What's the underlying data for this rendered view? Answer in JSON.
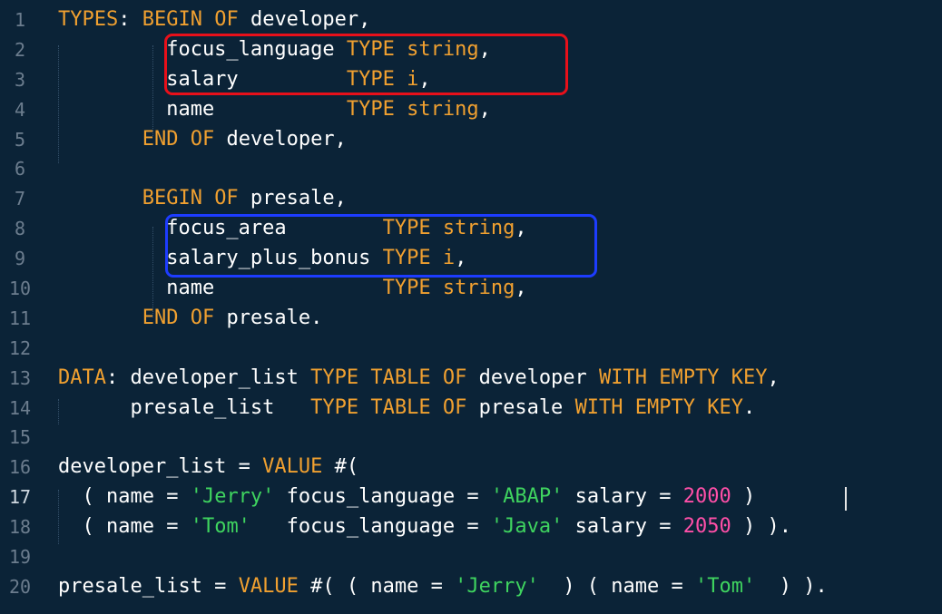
{
  "editor": {
    "active_line": 17,
    "colors": {
      "background": "#0b2337",
      "keyword": "#f0a030",
      "string": "#3fd45f",
      "number": "#ff4fa8",
      "identifier": "#ffffff",
      "line_number": "#6c7d8e",
      "highlight_red": "#e8101a",
      "highlight_blue": "#1d3cff"
    },
    "lines": [
      {
        "n": "1",
        "tokens": [
          {
            "t": "TYPES",
            "c": "kw"
          },
          {
            "t": ": ",
            "c": "id"
          },
          {
            "t": "BEGIN OF",
            "c": "kw"
          },
          {
            "t": " developer,",
            "c": "id"
          }
        ]
      },
      {
        "n": "2",
        "tokens": [
          {
            "t": "         focus_language ",
            "c": "id"
          },
          {
            "t": "TYPE",
            "c": "kw"
          },
          {
            "t": " ",
            "c": "id"
          },
          {
            "t": "string",
            "c": "kw"
          },
          {
            "t": ",",
            "c": "id"
          }
        ]
      },
      {
        "n": "3",
        "tokens": [
          {
            "t": "         salary         ",
            "c": "id"
          },
          {
            "t": "TYPE",
            "c": "kw"
          },
          {
            "t": " ",
            "c": "id"
          },
          {
            "t": "i",
            "c": "kw"
          },
          {
            "t": ",",
            "c": "id"
          }
        ]
      },
      {
        "n": "4",
        "tokens": [
          {
            "t": "         name           ",
            "c": "id"
          },
          {
            "t": "TYPE",
            "c": "kw"
          },
          {
            "t": " ",
            "c": "id"
          },
          {
            "t": "string",
            "c": "kw"
          },
          {
            "t": ",",
            "c": "id"
          }
        ]
      },
      {
        "n": "5",
        "tokens": [
          {
            "t": "       ",
            "c": "id"
          },
          {
            "t": "END OF",
            "c": "kw"
          },
          {
            "t": " developer,",
            "c": "id"
          }
        ]
      },
      {
        "n": "6",
        "tokens": []
      },
      {
        "n": "7",
        "tokens": [
          {
            "t": "       ",
            "c": "id"
          },
          {
            "t": "BEGIN OF",
            "c": "kw"
          },
          {
            "t": " presale,",
            "c": "id"
          }
        ]
      },
      {
        "n": "8",
        "tokens": [
          {
            "t": "         focus_area        ",
            "c": "id"
          },
          {
            "t": "TYPE",
            "c": "kw"
          },
          {
            "t": " ",
            "c": "id"
          },
          {
            "t": "string",
            "c": "kw"
          },
          {
            "t": ",",
            "c": "id"
          }
        ]
      },
      {
        "n": "9",
        "tokens": [
          {
            "t": "         salary_plus_bonus ",
            "c": "id"
          },
          {
            "t": "TYPE",
            "c": "kw"
          },
          {
            "t": " ",
            "c": "id"
          },
          {
            "t": "i",
            "c": "kw"
          },
          {
            "t": ",",
            "c": "id"
          }
        ]
      },
      {
        "n": "10",
        "tokens": [
          {
            "t": "         name              ",
            "c": "id"
          },
          {
            "t": "TYPE",
            "c": "kw"
          },
          {
            "t": " ",
            "c": "id"
          },
          {
            "t": "string",
            "c": "kw"
          },
          {
            "t": ",",
            "c": "id"
          }
        ]
      },
      {
        "n": "11",
        "tokens": [
          {
            "t": "       ",
            "c": "id"
          },
          {
            "t": "END OF",
            "c": "kw"
          },
          {
            "t": " presale.",
            "c": "id"
          }
        ]
      },
      {
        "n": "12",
        "tokens": []
      },
      {
        "n": "13",
        "tokens": [
          {
            "t": "DATA",
            "c": "kw"
          },
          {
            "t": ": developer_list ",
            "c": "id"
          },
          {
            "t": "TYPE TABLE OF",
            "c": "kw"
          },
          {
            "t": " developer ",
            "c": "id"
          },
          {
            "t": "WITH EMPTY KEY",
            "c": "kw"
          },
          {
            "t": ",",
            "c": "id"
          }
        ]
      },
      {
        "n": "14",
        "tokens": [
          {
            "t": "      presale_list   ",
            "c": "id"
          },
          {
            "t": "TYPE TABLE OF",
            "c": "kw"
          },
          {
            "t": " presale ",
            "c": "id"
          },
          {
            "t": "WITH EMPTY KEY",
            "c": "kw"
          },
          {
            "t": ".",
            "c": "id"
          }
        ]
      },
      {
        "n": "15",
        "tokens": []
      },
      {
        "n": "16",
        "tokens": [
          {
            "t": "developer_list = ",
            "c": "id"
          },
          {
            "t": "VALUE",
            "c": "kw"
          },
          {
            "t": " #(",
            "c": "id"
          }
        ]
      },
      {
        "n": "17",
        "tokens": [
          {
            "t": "  ( name = ",
            "c": "id"
          },
          {
            "t": "'Jerry'",
            "c": "str"
          },
          {
            "t": " focus_language = ",
            "c": "id"
          },
          {
            "t": "'ABAP'",
            "c": "str"
          },
          {
            "t": " salary = ",
            "c": "id"
          },
          {
            "t": "2000",
            "c": "num"
          },
          {
            "t": " )",
            "c": "id"
          }
        ]
      },
      {
        "n": "18",
        "tokens": [
          {
            "t": "  ( name = ",
            "c": "id"
          },
          {
            "t": "'Tom'",
            "c": "str"
          },
          {
            "t": "   focus_language = ",
            "c": "id"
          },
          {
            "t": "'Java'",
            "c": "str"
          },
          {
            "t": " salary = ",
            "c": "id"
          },
          {
            "t": "2050",
            "c": "num"
          },
          {
            "t": " ) ).",
            "c": "id"
          }
        ]
      },
      {
        "n": "19",
        "tokens": []
      },
      {
        "n": "20",
        "tokens": [
          {
            "t": "presale_list = ",
            "c": "id"
          },
          {
            "t": "VALUE",
            "c": "kw"
          },
          {
            "t": " #( ( name = ",
            "c": "id"
          },
          {
            "t": "'Jerry'",
            "c": "str"
          },
          {
            "t": "  ) ( name = ",
            "c": "id"
          },
          {
            "t": "'Tom'",
            "c": "str"
          },
          {
            "t": "  ) ).",
            "c": "id"
          }
        ]
      }
    ]
  }
}
